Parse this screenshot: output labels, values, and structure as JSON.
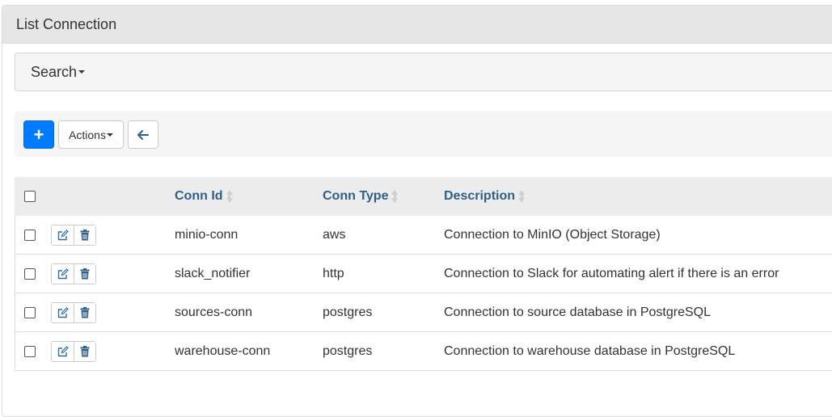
{
  "panel": {
    "title": "List Connection"
  },
  "search": {
    "label": "Search"
  },
  "toolbar": {
    "add_label": "+",
    "actions_label": "Actions",
    "primary_color": "#007bff"
  },
  "table": {
    "headers": {
      "conn_id": "Conn Id",
      "conn_type": "Conn Type",
      "description": "Description"
    },
    "rows": [
      {
        "conn_id": "minio-conn",
        "conn_type": "aws",
        "description": "Connection to MinIO (Object Storage)"
      },
      {
        "conn_id": "slack_notifier",
        "conn_type": "http",
        "description": "Connection to Slack for automating alert if there is an error"
      },
      {
        "conn_id": "sources-conn",
        "conn_type": "postgres",
        "description": "Connection to source database in PostgreSQL"
      },
      {
        "conn_id": "warehouse-conn",
        "conn_type": "postgres",
        "description": "Connection to warehouse database in PostgreSQL"
      }
    ]
  },
  "icons": {
    "edit": "edit-icon",
    "delete": "trash-icon",
    "back": "arrow-left-icon",
    "sort": "sort-icon",
    "caret": "caret-down-icon"
  }
}
